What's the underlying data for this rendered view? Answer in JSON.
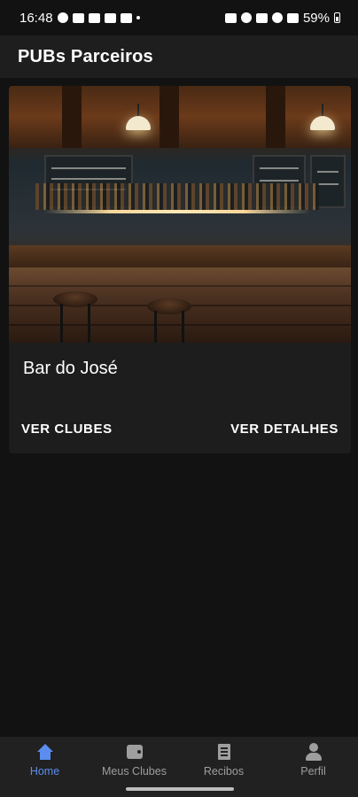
{
  "status_bar": {
    "time": "16:48",
    "battery": "59%"
  },
  "app_bar": {
    "title": "PUBs Parceiros"
  },
  "pubs": [
    {
      "name": "Bar do José",
      "actions": {
        "clubs_label": "VER CLUBES",
        "details_label": "VER DETALHES"
      }
    }
  ],
  "bottom_nav": {
    "items": [
      {
        "label": "Home",
        "icon": "home-icon",
        "active": true
      },
      {
        "label": "Meus Clubes",
        "icon": "wallet-icon",
        "active": false
      },
      {
        "label": "Recibos",
        "icon": "receipt-icon",
        "active": false
      },
      {
        "label": "Perfil",
        "icon": "person-icon",
        "active": false
      }
    ]
  },
  "colors": {
    "background": "#121212",
    "app_bar": "#1e1e1e",
    "card": "#1d1d1d",
    "nav_active": "#5b8def",
    "nav_inactive": "#9e9e9e"
  }
}
